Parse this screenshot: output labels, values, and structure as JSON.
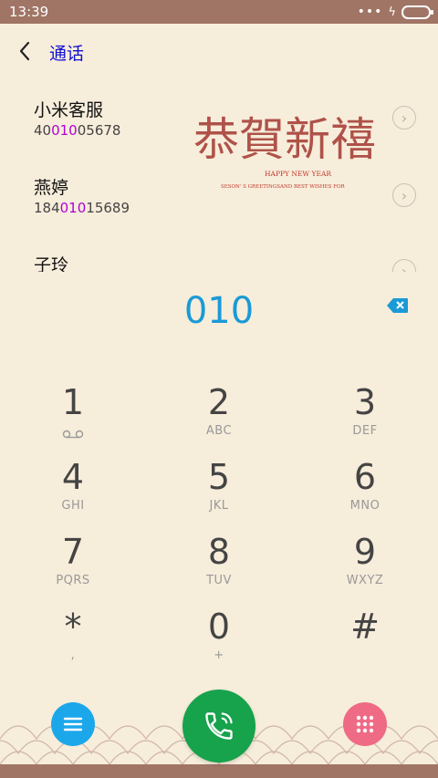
{
  "status_bar": {
    "time": "13:39",
    "icons": [
      "more-dots-icon",
      "charging-icon",
      "battery-icon"
    ]
  },
  "header": {
    "title": "通话",
    "back_icon": "back-arrow-icon"
  },
  "contacts": [
    {
      "name": "小米客服",
      "number_pre": "40",
      "number_match": "010",
      "number_post": "05678"
    },
    {
      "name": "燕婷",
      "number_pre": "184",
      "number_match": "010",
      "number_post": "15689"
    },
    {
      "name": "子玲",
      "number_pre": "",
      "number_match": "",
      "number_post": ""
    }
  ],
  "banner": {
    "calligraphy": "恭賀新禧",
    "subtitle": "HAPPY NEW YEAR",
    "tagline": "SESON' S GREETINGSAND BEST WISHES FOR"
  },
  "dialer": {
    "input_value": "010",
    "keys": [
      {
        "num": "1",
        "sub": ""
      },
      {
        "num": "2",
        "sub": "ABC"
      },
      {
        "num": "3",
        "sub": "DEF"
      },
      {
        "num": "4",
        "sub": "GHI"
      },
      {
        "num": "5",
        "sub": "JKL"
      },
      {
        "num": "6",
        "sub": "MNO"
      },
      {
        "num": "7",
        "sub": "PQRS"
      },
      {
        "num": "8",
        "sub": "TUV"
      },
      {
        "num": "9",
        "sub": "WXYZ"
      },
      {
        "num": "*",
        "sub": ","
      },
      {
        "num": "0",
        "sub": "+"
      },
      {
        "num": "#",
        "sub": ""
      }
    ]
  },
  "colors": {
    "accent": "#1a9ad6",
    "match": "#b100d6",
    "call": "#17a24c",
    "menu": "#1ca7ea",
    "pad": "#ef6a85",
    "status": "#a07565",
    "background": "#f7eddb"
  }
}
